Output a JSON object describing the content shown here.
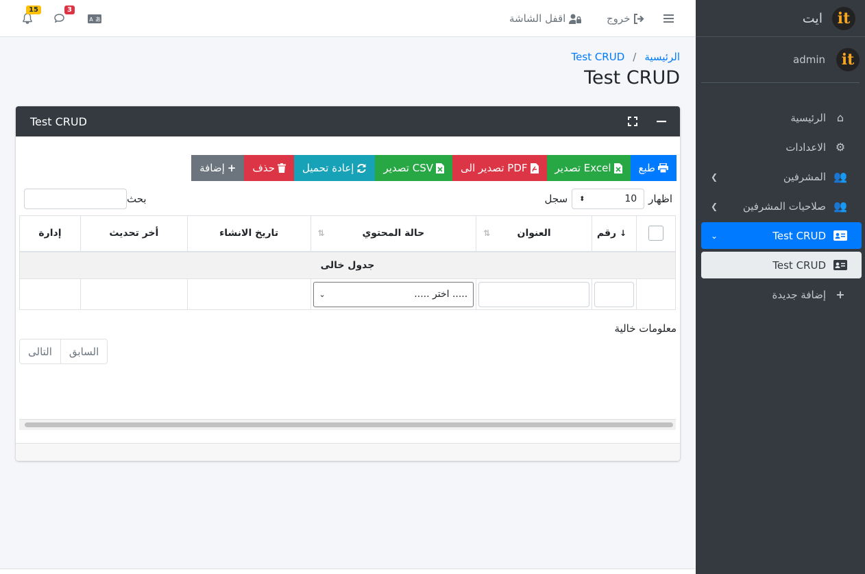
{
  "topbar": {
    "menu_icon": "bars-icon",
    "logout_label": "خروج",
    "lock_label": "اقفل الشاشة",
    "notifications_count": "15",
    "messages_count": "3"
  },
  "sidebar": {
    "brand": "ايت",
    "user": "admin",
    "items": [
      {
        "label": "الرئيسية",
        "icon": "home-icon"
      },
      {
        "label": "الاعدادات",
        "icon": "cogs-icon"
      },
      {
        "label": "المشرفين",
        "icon": "users-icon"
      },
      {
        "label": "صلاحيات المشرفين",
        "icon": "users-icon"
      },
      {
        "label": "Test CRUD",
        "icon": "id-card-icon"
      },
      {
        "label": "Test CRUD",
        "icon": "id-card-icon"
      },
      {
        "label": "إضافة جديدة",
        "icon": "plus-icon"
      }
    ]
  },
  "breadcrumb": {
    "home": "الرئيسية",
    "sep": "/",
    "current": "Test CRUD"
  },
  "page_title": "Test CRUD",
  "card": {
    "title": "Test CRUD",
    "toolbar": {
      "print": "طبع",
      "excel": "تصدير Excel",
      "pdf": "تصدير الى PDF",
      "csv": "تصدير CSV",
      "reload": "إعادة تحميل",
      "delete": "حذف",
      "add": "إضافة"
    },
    "show_label": "اظهار",
    "page_size": "10",
    "records_label": "سجل",
    "search_label": "بحث",
    "columns": [
      "رقم",
      "العنوان",
      "حالة المحتوي",
      "تاريخ الانشاء",
      "أخر تحديث",
      "إدارة"
    ],
    "empty_text": "جدول خالى",
    "status_filter_placeholder": "..... اختر .....",
    "info_text": "معلومات خالية",
    "prev": "السابق",
    "next": "التالى"
  },
  "colors": {
    "primary": "#007bff",
    "dark": "#343a40",
    "success": "#28a745",
    "danger": "#dc3545",
    "info": "#17a2b8",
    "secondary": "#6c757d"
  }
}
